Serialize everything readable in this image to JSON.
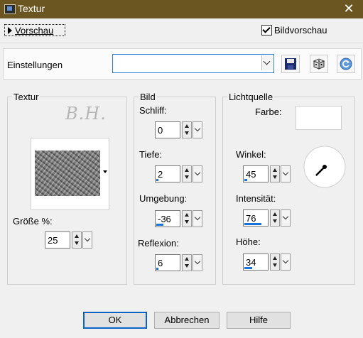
{
  "window": {
    "title": "Textur",
    "close_glyph": "✕",
    "app_icon": "dialog-app-icon"
  },
  "preview": {
    "label": "Vorschau",
    "icon": "triangle-right-icon"
  },
  "checkbox": {
    "label": "Bildvorschau",
    "checked": true
  },
  "settings": {
    "label": "Einstellungen",
    "combo_value": "",
    "buttons": [
      "save-preset-icon",
      "randomize-dice-icon",
      "reset-icon"
    ]
  },
  "texture_group": {
    "legend": "Textur",
    "signature": "B.H.",
    "size_label": "Größe %:",
    "size_value": "25"
  },
  "bild_group": {
    "legend": "Bild",
    "fields": [
      {
        "label": "Schliff:",
        "value": "0",
        "level": 0
      },
      {
        "label": "Tiefe:",
        "value": "2",
        "level": 0.02
      },
      {
        "label": "Umgebung:",
        "value": "-36",
        "level": 0.32
      },
      {
        "label": "Reflexion:",
        "value": "6",
        "level": 0.06
      }
    ]
  },
  "light_group": {
    "legend": "Lichtquelle",
    "color_label": "Farbe:",
    "color_value": "#ffffff",
    "fields": [
      {
        "label": "Winkel:",
        "value": "45",
        "level": 0.125
      },
      {
        "label": "Intensität:",
        "value": "76",
        "level": 0.76
      },
      {
        "label": "Höhe:",
        "value": "34",
        "level": 0.34
      }
    ],
    "angle_degrees": 45
  },
  "footer": {
    "ok": "OK",
    "cancel": "Abbrechen",
    "help": "Hilfe"
  },
  "colors": {
    "titlebar": "#6b5521",
    "accent": "#1a73d9",
    "focus": "#0a64c8"
  }
}
